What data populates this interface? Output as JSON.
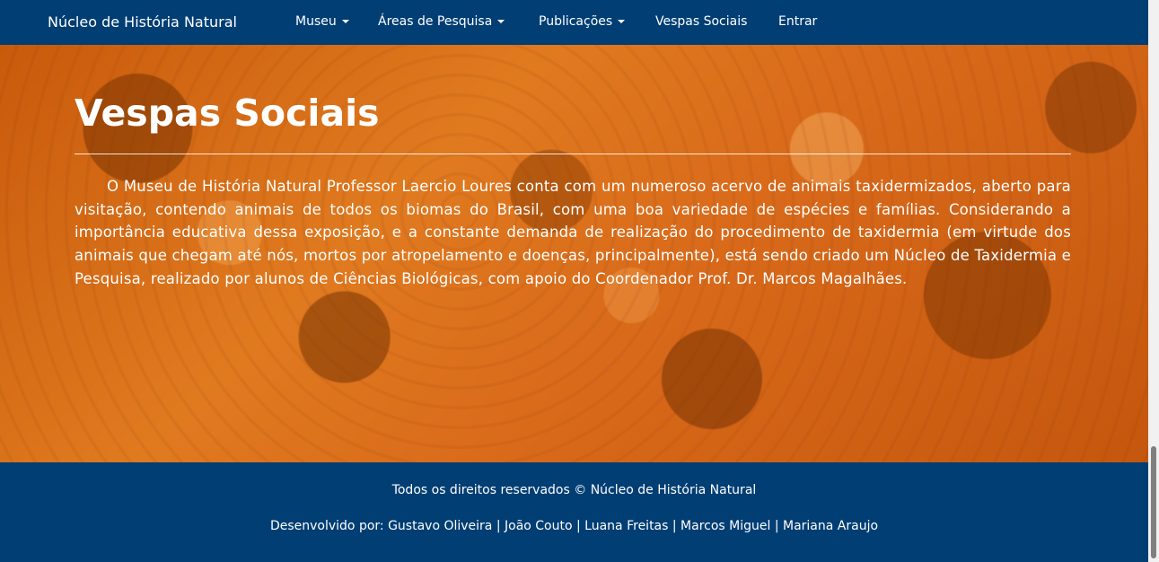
{
  "navbar": {
    "brand": "Núcleo de História Natural",
    "items": [
      {
        "label": "Museu"
      },
      {
        "label": "Áreas de Pesquisa"
      },
      {
        "label": "Publicações"
      },
      {
        "label": "Vespas Sociais"
      },
      {
        "label": "Entrar"
      }
    ]
  },
  "hero": {
    "title": "Vespas Sociais",
    "paragraph": "O Museu de História Natural Professor Laercio Loures conta com um numeroso acervo de animais taxidermizados, aberto para visitação, contendo animais de todos os biomas do Brasil, com uma boa variedade de espécies e famílias. Considerando a importância educativa dessa exposição, e a constante demanda de realização do procedimento de taxidermia  (em virtude dos animais que chegam até nós, mortos por atropelamento e doenças, principalmente), está sendo criado um Núcleo de Taxidermia e Pesquisa, realizado por alunos de Ciências Biológicas, com apoio do Coordenador Prof. Dr. Marcos Magalhães."
  },
  "footer": {
    "copyright": "Todos os direitos reservados © Núcleo de História Natural",
    "credits": "Desenvolvido por: Gustavo Oliveira | João Couto | Luana Freitas | Marcos Miguel | Mariana Araujo"
  },
  "colors": {
    "navbar_bg": "#003e74",
    "hero_tint": "#e07a1f"
  }
}
